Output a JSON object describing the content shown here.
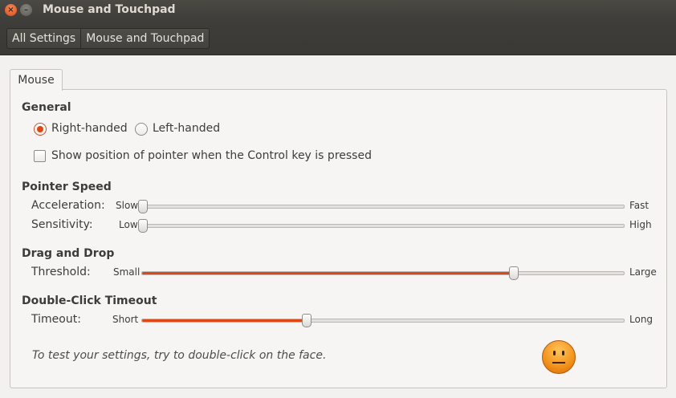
{
  "window": {
    "title": "Mouse and Touchpad",
    "close_glyph": "×",
    "minimize_glyph": "–"
  },
  "breadcrumbs": [
    "All Settings",
    "Mouse and Touchpad"
  ],
  "tab": {
    "label": "Mouse"
  },
  "general": {
    "heading": "General",
    "right_handed": "Right-handed",
    "left_handed": "Left-handed",
    "selected": "Right-handed",
    "show_pointer": "Show position of pointer when the Control key is pressed",
    "show_pointer_checked": false
  },
  "pointer_speed": {
    "heading": "Pointer Speed",
    "acceleration": {
      "label": "Acceleration:",
      "min": "Slow",
      "max": "Fast",
      "value": 0.0
    },
    "sensitivity": {
      "label": "Sensitivity:",
      "min": "Low",
      "max": "High",
      "value": 0.0
    }
  },
  "drag_drop": {
    "heading": "Drag and Drop",
    "threshold": {
      "label": "Threshold:",
      "min": "Small",
      "max": "Large",
      "value": 0.77
    }
  },
  "double_click": {
    "heading": "Double-Click Timeout",
    "timeout": {
      "label": "Timeout:",
      "min": "Short",
      "max": "Long",
      "value": 0.34
    },
    "hint": "To test your settings, try to double-click on the face."
  },
  "colors": {
    "accent": "#dd4814",
    "titlebar": "#3e3d39",
    "background": "#f2f1f0"
  },
  "icons": {
    "face": "neutral-face-icon"
  }
}
